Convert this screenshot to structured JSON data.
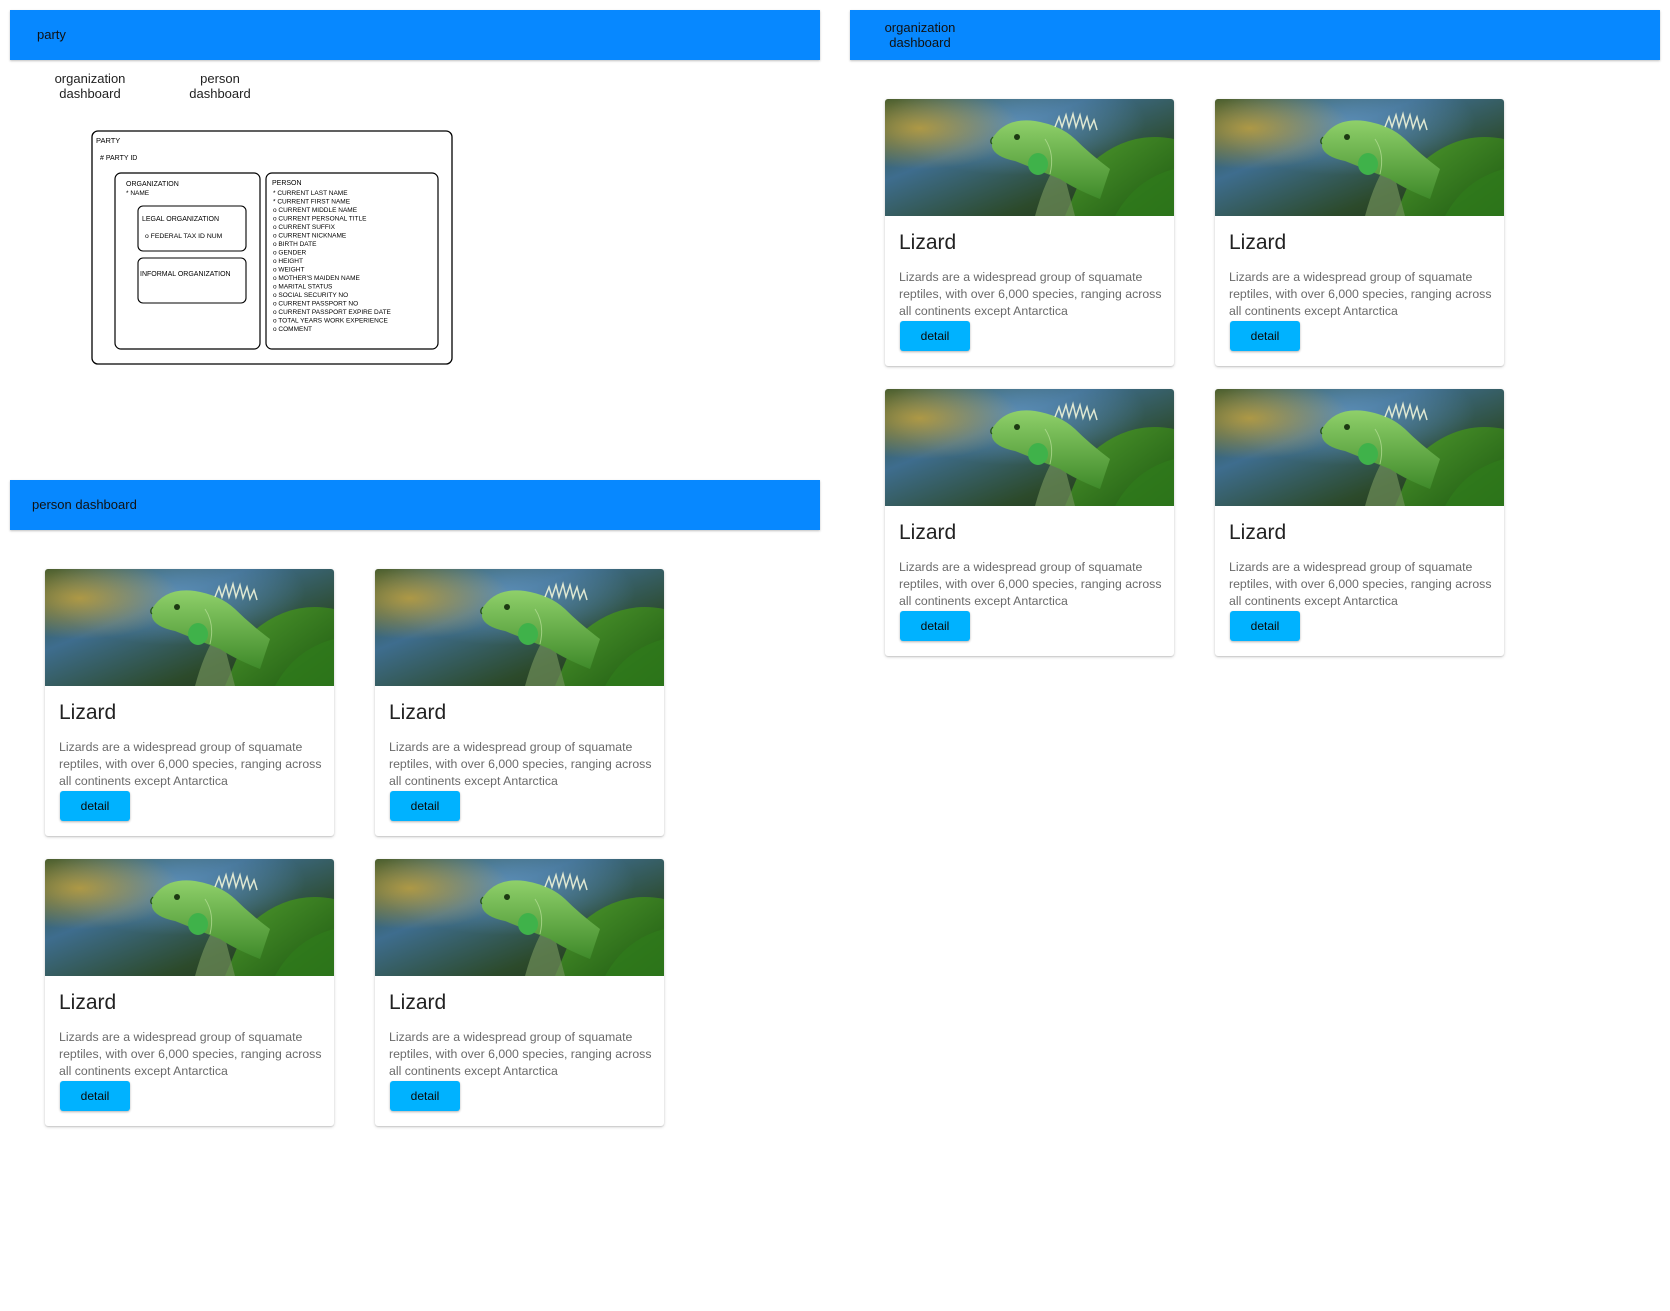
{
  "party_page": {
    "appbar_title": "party",
    "nav": {
      "organization_dashboard": "organization\ndashboard",
      "person_dashboard": "person\ndashboard"
    },
    "diagram": {
      "party_label": "PARTY",
      "party_id": "# PARTY ID",
      "organization": {
        "label": "ORGANIZATION",
        "attribute": "* NAME",
        "legal_label": "LEGAL ORGANIZATION",
        "legal_attribute": "o FEDERAL TAX ID NUM",
        "informal_label": "INFORMAL ORGANIZATION"
      },
      "person": {
        "label": "PERSON",
        "attributes": [
          "* CURRENT LAST NAME",
          "* CURRENT FIRST NAME",
          "o CURRENT MIDDLE NAME",
          "o CURRENT PERSONAL TITLE",
          "o CURRENT SUFFIX",
          "o CURRENT NICKNAME",
          "o BIRTH DATE",
          "o GENDER",
          "o HEIGHT",
          "o WEIGHT",
          "o MOTHER'S MAIDEN NAME",
          "o MARITAL STATUS",
          "o SOCIAL SECURITY NO",
          "o CURRENT PASSPORT NO",
          "o CURRENT PASSPORT EXPIRE DATE",
          "o TOTAL YEARS WORK EXPERIENCE",
          "o COMMENT"
        ]
      }
    }
  },
  "person_page": {
    "appbar_title": "person dashboard",
    "cards": [
      {
        "title": "Lizard",
        "description": "Lizards are a widespread group of squamate reptiles, with over 6,000 species, ranging across all continents except Antarctica",
        "button": "detail"
      },
      {
        "title": "Lizard",
        "description": "Lizards are a widespread group of squamate reptiles, with over 6,000 species, ranging across all continents except Antarctica",
        "button": "detail"
      },
      {
        "title": "Lizard",
        "description": "Lizards are a widespread group of squamate reptiles, with over 6,000 species, ranging across all continents except Antarctica",
        "button": "detail"
      },
      {
        "title": "Lizard",
        "description": "Lizards are a widespread group of squamate reptiles, with over 6,000 species, ranging across all continents except Antarctica",
        "button": "detail"
      }
    ]
  },
  "organization_page": {
    "appbar_title": "organization\ndashboard",
    "cards": [
      {
        "title": "Lizard",
        "description": "Lizards are a widespread group of squamate reptiles, with over 6,000 species, ranging across all continents except Antarctica",
        "button": "detail"
      },
      {
        "title": "Lizard",
        "description": "Lizards are a widespread group of squamate reptiles, with over 6,000 species, ranging across all continents except Antarctica",
        "button": "detail"
      },
      {
        "title": "Lizard",
        "description": "Lizards are a widespread group of squamate reptiles, with over 6,000 species, ranging across all continents except Antarctica",
        "button": "detail"
      },
      {
        "title": "Lizard",
        "description": "Lizards are a widespread group of squamate reptiles, with over 6,000 species, ranging across all continents except Antarctica",
        "button": "detail"
      }
    ]
  },
  "colors": {
    "appbar": "#0788ff",
    "button": "#00b2ff"
  }
}
